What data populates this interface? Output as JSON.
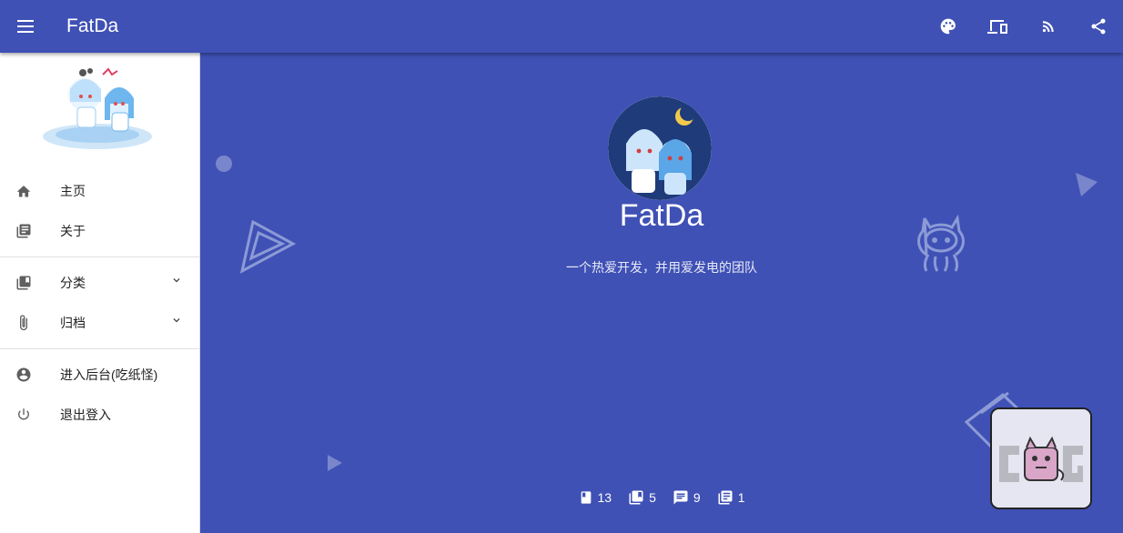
{
  "header": {
    "title": "FatDa",
    "menu_icon": "menu-icon",
    "actions": [
      "palette-icon",
      "devices-icon",
      "rss-icon",
      "share-icon"
    ]
  },
  "sidebar": {
    "items": [
      {
        "label": "主页",
        "icon": "home-icon"
      },
      {
        "label": "关于",
        "icon": "article-icon"
      },
      {
        "label": "分类",
        "icon": "library-icon"
      },
      {
        "label": "归档",
        "icon": "attachment-icon"
      },
      {
        "label": "进入后台(吃纸怪)",
        "icon": "account-icon"
      },
      {
        "label": "退出登入",
        "icon": "power-icon"
      }
    ]
  },
  "main": {
    "brand": "FatDa",
    "description": "一个热爱开发，并用爱发电的团队",
    "stats": [
      {
        "icon": "bookmark-icon",
        "value": "13"
      },
      {
        "icon": "library-icon",
        "value": "5"
      },
      {
        "icon": "comment-icon",
        "value": "9"
      },
      {
        "icon": "article-icon",
        "value": "1"
      }
    ]
  },
  "colors": {
    "primary": "#3f51b5",
    "drawer": "#ffffff"
  }
}
